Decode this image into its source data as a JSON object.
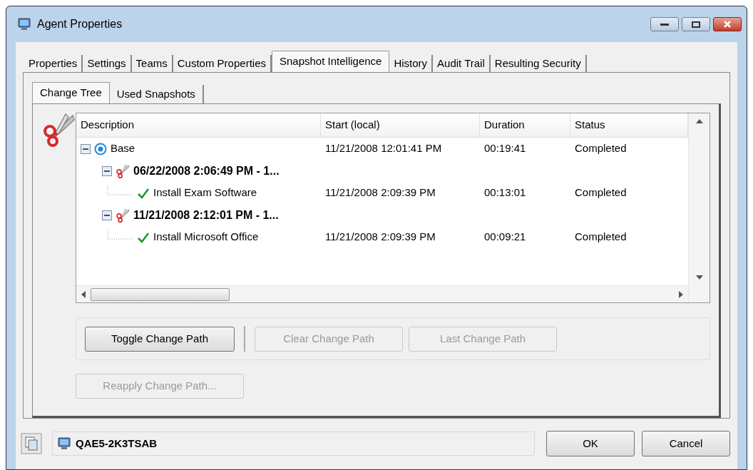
{
  "window": {
    "title": "Agent Properties"
  },
  "tabs": [
    {
      "label": "Properties",
      "selected": false
    },
    {
      "label": "Settings",
      "selected": false
    },
    {
      "label": "Teams",
      "selected": false
    },
    {
      "label": "Custom Properties",
      "selected": false
    },
    {
      "label": "Snapshot Intelligence",
      "selected": true
    },
    {
      "label": "History",
      "selected": false
    },
    {
      "label": "Audit Trail",
      "selected": false
    },
    {
      "label": "Resulting Security",
      "selected": false
    }
  ],
  "subtabs": [
    {
      "label": "Change Tree",
      "selected": true
    },
    {
      "label": "Used Snapshots",
      "selected": false
    }
  ],
  "tree": {
    "columns": [
      "Description",
      "Start (local)",
      "Duration",
      "Status"
    ],
    "rows": [
      {
        "kind": "base",
        "description": "Base",
        "start": "11/21/2008 12:01:41 PM",
        "duration": "00:19:41",
        "status": "Completed",
        "expanded": true,
        "children": [
          {
            "kind": "snapshot",
            "description": "06/22/2008 2:06:49 PM - 1...",
            "expanded": true,
            "children": [
              {
                "kind": "task",
                "description": "Install Exam Software",
                "start": "11/21/2008 2:09:39 PM",
                "duration": "00:13:01",
                "status": "Completed"
              }
            ]
          },
          {
            "kind": "snapshot",
            "description": "11/21/2008 2:12:01 PM - 1...",
            "expanded": true,
            "children": [
              {
                "kind": "task",
                "description": "Install Microsoft Office",
                "start": "11/21/2008 2:09:39 PM",
                "duration": "00:09:21",
                "status": "Completed"
              }
            ]
          }
        ]
      }
    ]
  },
  "path_buttons": [
    {
      "label": "Toggle Change Path",
      "disabled": false
    },
    {
      "label": "Clear Change Path",
      "disabled": true
    },
    {
      "label": "Last Change Path",
      "disabled": true
    }
  ],
  "reapply_button": {
    "label": "Reapply Change Path...",
    "disabled": true
  },
  "machine": {
    "name": "QAE5-2K3TSAB"
  },
  "buttons": [
    {
      "label": "OK"
    },
    {
      "label": "Cancel"
    }
  ]
}
